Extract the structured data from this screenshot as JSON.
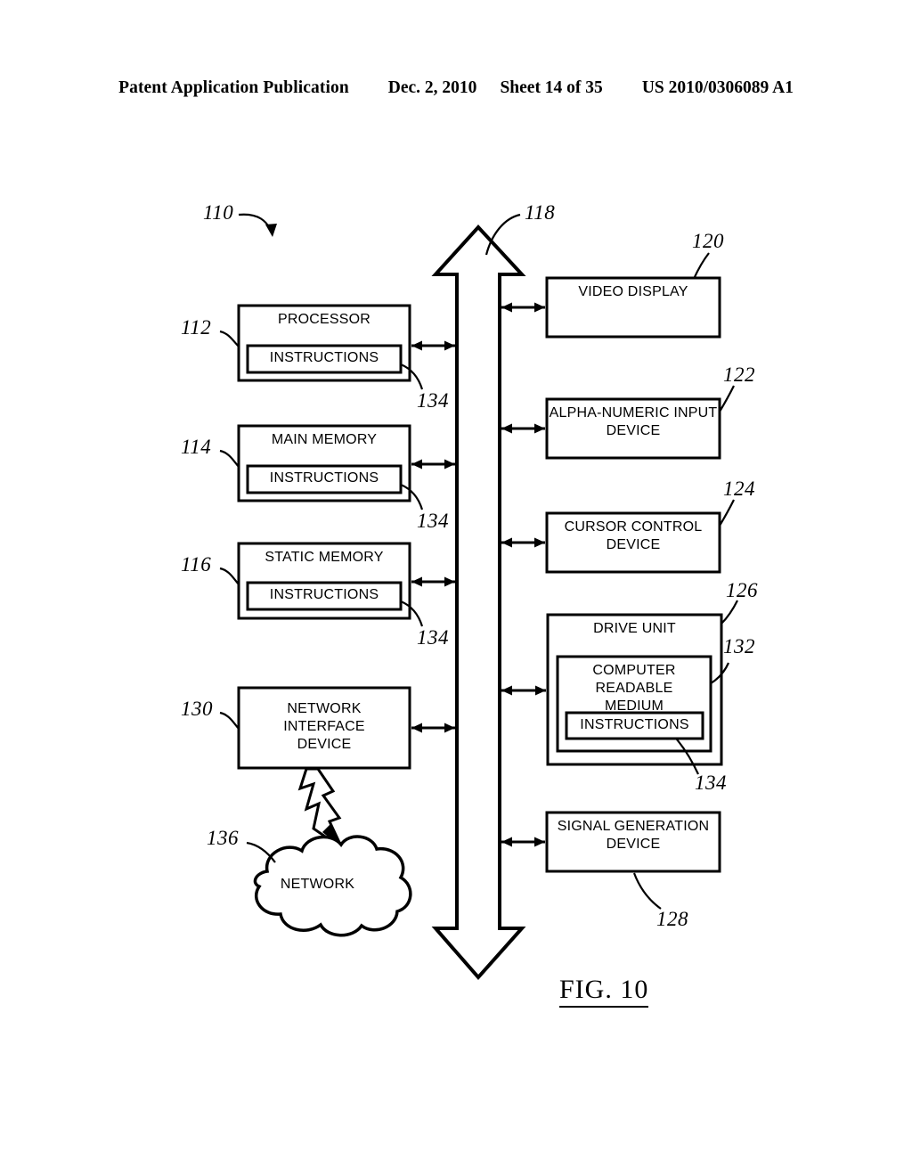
{
  "header": {
    "publication": "Patent Application Publication",
    "date": "Dec. 2, 2010",
    "sheet": "Sheet 14 of 35",
    "patent_number": "US 2010/0306089 A1"
  },
  "figure": {
    "caption": "FIG. 10",
    "system_ref": "110",
    "bus_ref": "118"
  },
  "left_column": [
    {
      "ref": "112",
      "title": "PROCESSOR",
      "inner_label": "INSTRUCTIONS",
      "inner_ref": "134"
    },
    {
      "ref": "114",
      "title": "MAIN MEMORY",
      "inner_label": "INSTRUCTIONS",
      "inner_ref": "134"
    },
    {
      "ref": "116",
      "title": "STATIC MEMORY",
      "inner_label": "INSTRUCTIONS",
      "inner_ref": "134"
    },
    {
      "ref": "130",
      "title": "NETWORK\nINTERFACE\nDEVICE"
    }
  ],
  "network": {
    "ref": "136",
    "label": "NETWORK"
  },
  "right_column": [
    {
      "ref": "120",
      "title": "VIDEO DISPLAY"
    },
    {
      "ref": "122",
      "title": "ALPHA-NUMERIC INPUT\nDEVICE"
    },
    {
      "ref": "124",
      "title": "CURSOR CONTROL\nDEVICE"
    },
    {
      "ref": "126",
      "title": "DRIVE UNIT",
      "medium_ref": "132",
      "medium_label": "COMPUTER READABLE\nMEDIUM",
      "inner_label": "INSTRUCTIONS",
      "inner_ref": "134"
    },
    {
      "ref": "128",
      "title": "SIGNAL GENERATION\nDEVICE"
    }
  ],
  "colors": {
    "ink": "#000000",
    "paper": "#ffffff"
  }
}
